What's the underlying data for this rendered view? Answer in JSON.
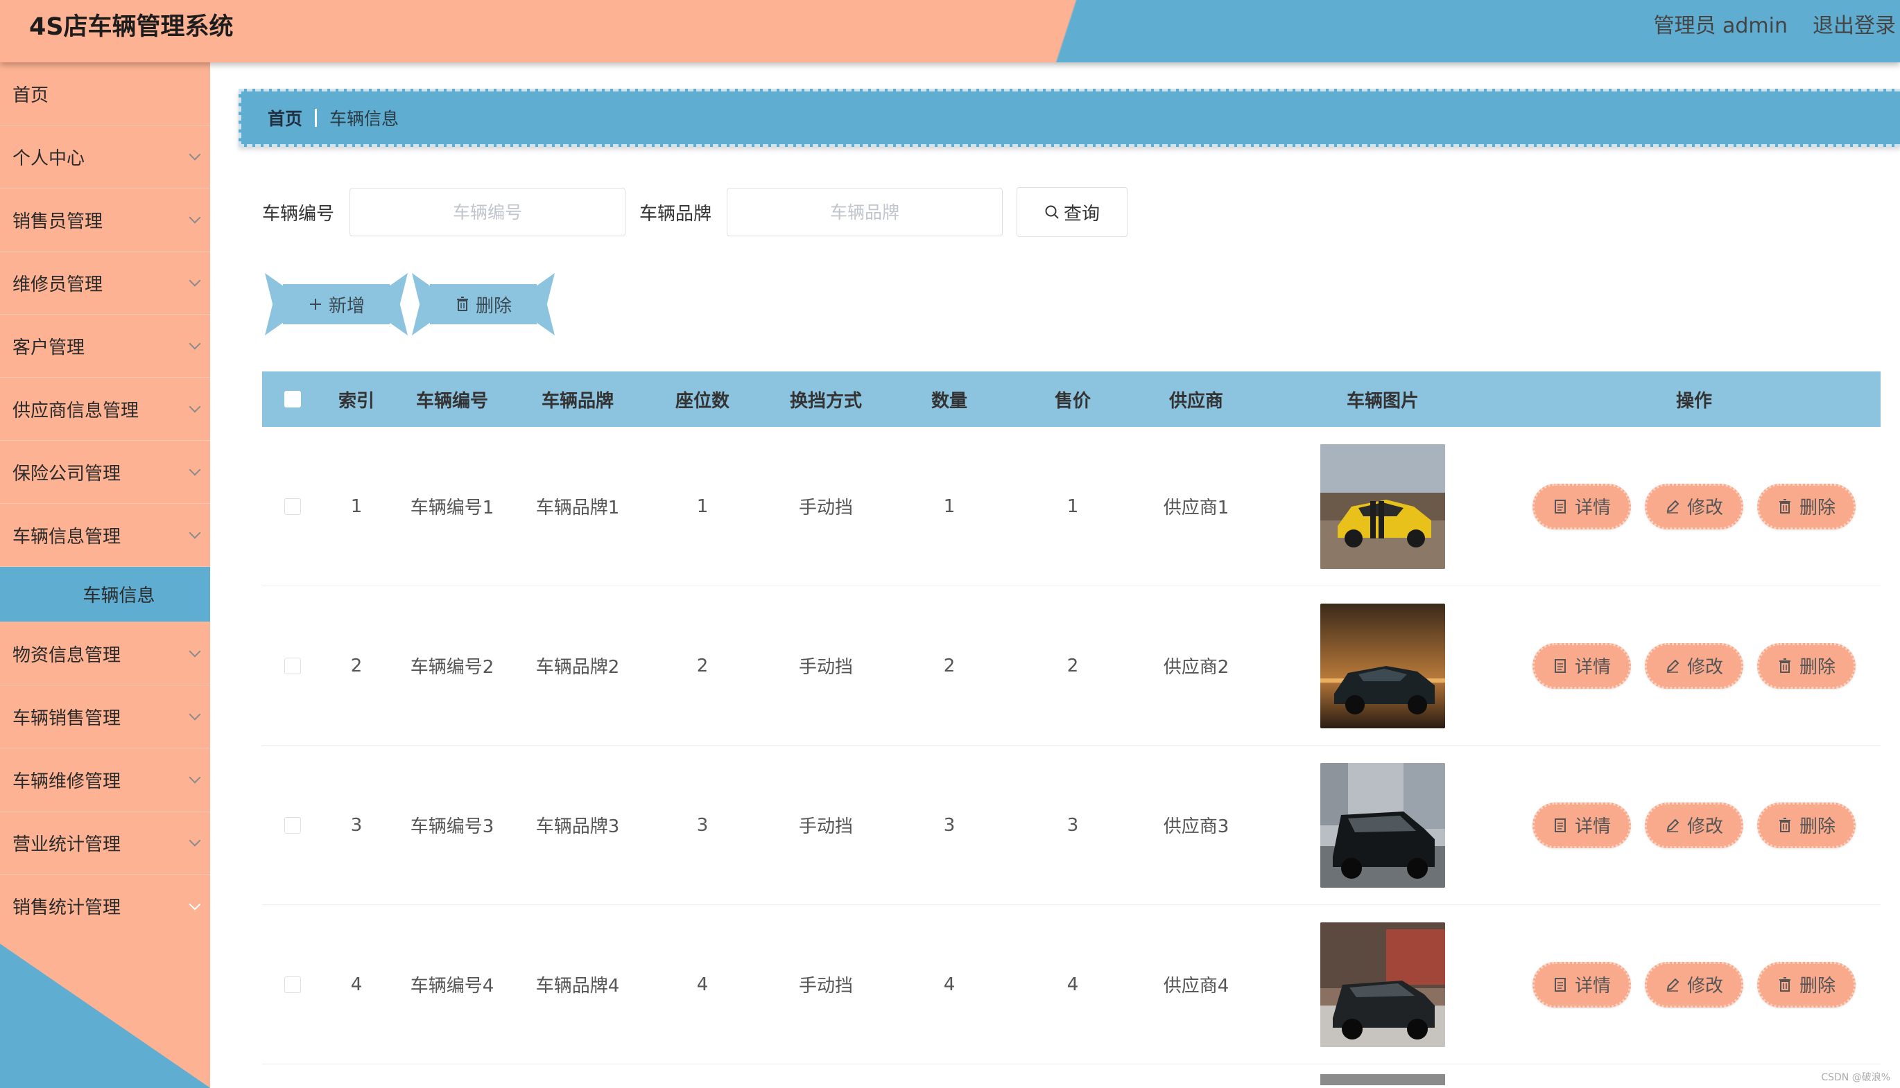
{
  "header": {
    "title": "4S店车辆管理系统",
    "user": "管理员 admin",
    "logout": "退出登录"
  },
  "colors": {
    "primary_orange": "#fdb393",
    "primary_blue": "#5fadd1",
    "table_head": "#8cc3df",
    "op_button": "#f9a98c"
  },
  "sidebar": {
    "items": [
      {
        "label": "首页",
        "chevron": false
      },
      {
        "label": "个人中心",
        "chevron": true
      },
      {
        "label": "销售员管理",
        "chevron": true
      },
      {
        "label": "维修员管理",
        "chevron": true
      },
      {
        "label": "客户管理",
        "chevron": true
      },
      {
        "label": "供应商信息管理",
        "chevron": true
      },
      {
        "label": "保险公司管理",
        "chevron": true
      },
      {
        "label": "车辆信息管理",
        "chevron": true,
        "expanded": true
      },
      {
        "label": "物资信息管理",
        "chevron": true
      },
      {
        "label": "车辆销售管理",
        "chevron": true
      },
      {
        "label": "车辆维修管理",
        "chevron": true
      },
      {
        "label": "营业统计管理",
        "chevron": true
      },
      {
        "label": "销售统计管理",
        "chevron": true
      }
    ],
    "active_sub": "车辆信息"
  },
  "breadcrumb": {
    "home": "首页",
    "current": "车辆信息"
  },
  "search": {
    "vehicle_no_label": "车辆编号",
    "vehicle_no_placeholder": "车辆编号",
    "vehicle_no_value": "",
    "brand_label": "车辆品牌",
    "brand_placeholder": "车辆品牌",
    "brand_value": "",
    "query_label": "查询",
    "query_icon": "search-icon"
  },
  "actions": {
    "add_label": "新增",
    "add_icon": "plus-icon",
    "delete_label": "删除",
    "delete_icon": "trash-icon"
  },
  "table": {
    "columns": [
      "索引",
      "车辆编号",
      "车辆品牌",
      "座位数",
      "换挡方式",
      "数量",
      "售价",
      "供应商",
      "车辆图片",
      "操作"
    ],
    "rows": [
      {
        "index": "1",
        "no": "车辆编号1",
        "brand": "车辆品牌1",
        "seats": "1",
        "gear": "手动挡",
        "qty": "1",
        "price": "1",
        "supplier": "供应商1",
        "image": "yellow-sports-car"
      },
      {
        "index": "2",
        "no": "车辆编号2",
        "brand": "车辆品牌2",
        "seats": "2",
        "gear": "手动挡",
        "qty": "2",
        "price": "2",
        "supplier": "供应商2",
        "image": "dark-sports-car-sunset"
      },
      {
        "index": "3",
        "no": "车辆编号3",
        "brand": "车辆品牌3",
        "seats": "3",
        "gear": "手动挡",
        "qty": "3",
        "price": "3",
        "supplier": "供应商3",
        "image": "black-suv-street"
      },
      {
        "index": "4",
        "no": "车辆编号4",
        "brand": "车辆品牌4",
        "seats": "4",
        "gear": "手动挡",
        "qty": "4",
        "price": "4",
        "supplier": "供应商4",
        "image": "black-suv-building"
      }
    ],
    "row_actions": {
      "detail_label": "详情",
      "detail_icon": "document-icon",
      "edit_label": "修改",
      "edit_icon": "pencil-icon",
      "delete_label": "删除",
      "delete_icon": "trash-icon"
    }
  },
  "watermark": "CSDN @破浪%"
}
